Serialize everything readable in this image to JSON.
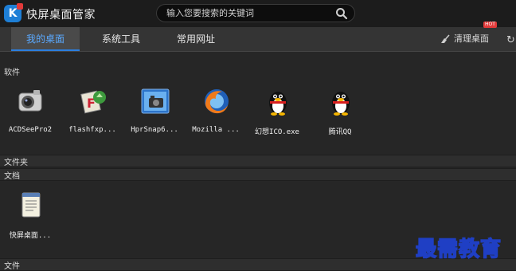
{
  "app": {
    "title": "快屏桌面管家",
    "logo_letter": "K"
  },
  "search": {
    "placeholder": "输入您要搜索的关键词"
  },
  "tabs": [
    {
      "label": "我的桌面",
      "active": true
    },
    {
      "label": "系统工具",
      "active": false
    },
    {
      "label": "常用网址",
      "active": false
    }
  ],
  "toolbar": {
    "clean_label": "清理桌面",
    "badge": "HOT"
  },
  "sections": {
    "software": "软件",
    "folders": "文件夹",
    "documents": "文档",
    "files": "文件"
  },
  "software_items": [
    {
      "label": "ACDSeePro2",
      "icon": "acdsee-icon"
    },
    {
      "label": "flashfxp...",
      "icon": "flashfxp-icon"
    },
    {
      "label": "HprSnap6...",
      "icon": "hypersnap-icon"
    },
    {
      "label": "Mozilla ...",
      "icon": "firefox-icon"
    },
    {
      "label": "幻想ICO.exe",
      "icon": "qq-penguin-icon"
    },
    {
      "label": "腾讯QQ",
      "icon": "qq-penguin-icon"
    }
  ],
  "document_items": [
    {
      "label": "快屏桌面...",
      "icon": "notepad-icon"
    }
  ],
  "watermark": "最需教育",
  "colors": {
    "accent": "#2b7fe0",
    "active_tab_text": "#5aa9ff",
    "background": "#262626",
    "badge": "#e23a3a"
  }
}
